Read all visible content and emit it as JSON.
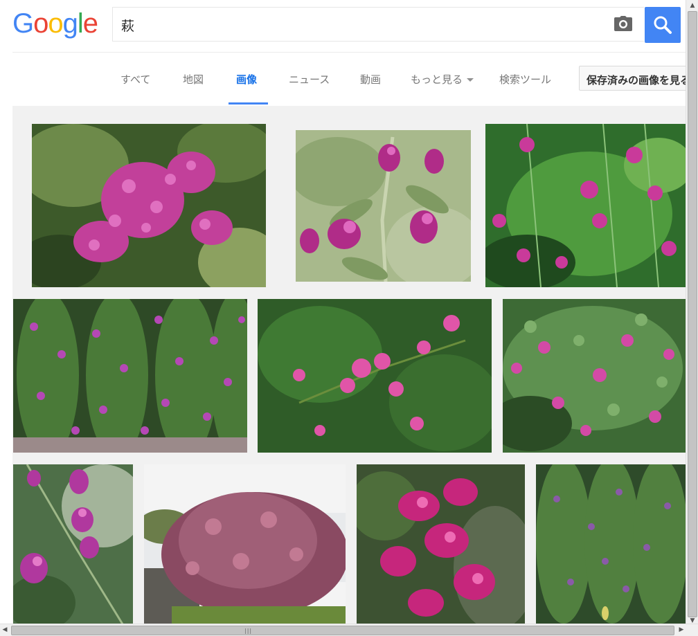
{
  "brand": {
    "logo_letters": [
      {
        "char": "G",
        "color": "#4285f4"
      },
      {
        "char": "o",
        "color": "#ea4335"
      },
      {
        "char": "o",
        "color": "#fbbc05"
      },
      {
        "char": "g",
        "color": "#4285f4"
      },
      {
        "char": "l",
        "color": "#34a853"
      },
      {
        "char": "e",
        "color": "#ea4335"
      }
    ]
  },
  "search": {
    "query": "萩",
    "camera_icon": "camera-icon",
    "submit_icon": "magnifier-icon",
    "accent_color": "#4285f4"
  },
  "tabs": [
    {
      "label": "すべて",
      "active": false
    },
    {
      "label": "地図",
      "active": false
    },
    {
      "label": "画像",
      "active": true
    },
    {
      "label": "ニュース",
      "active": false
    },
    {
      "label": "動画",
      "active": false
    },
    {
      "label": "もっと見る",
      "active": false,
      "has_dropdown": true
    },
    {
      "label": "検索ツール",
      "active": false
    }
  ],
  "saved_images_label": "保存済みの画像を見る",
  "results": {
    "count": 10,
    "subject": "萩"
  }
}
